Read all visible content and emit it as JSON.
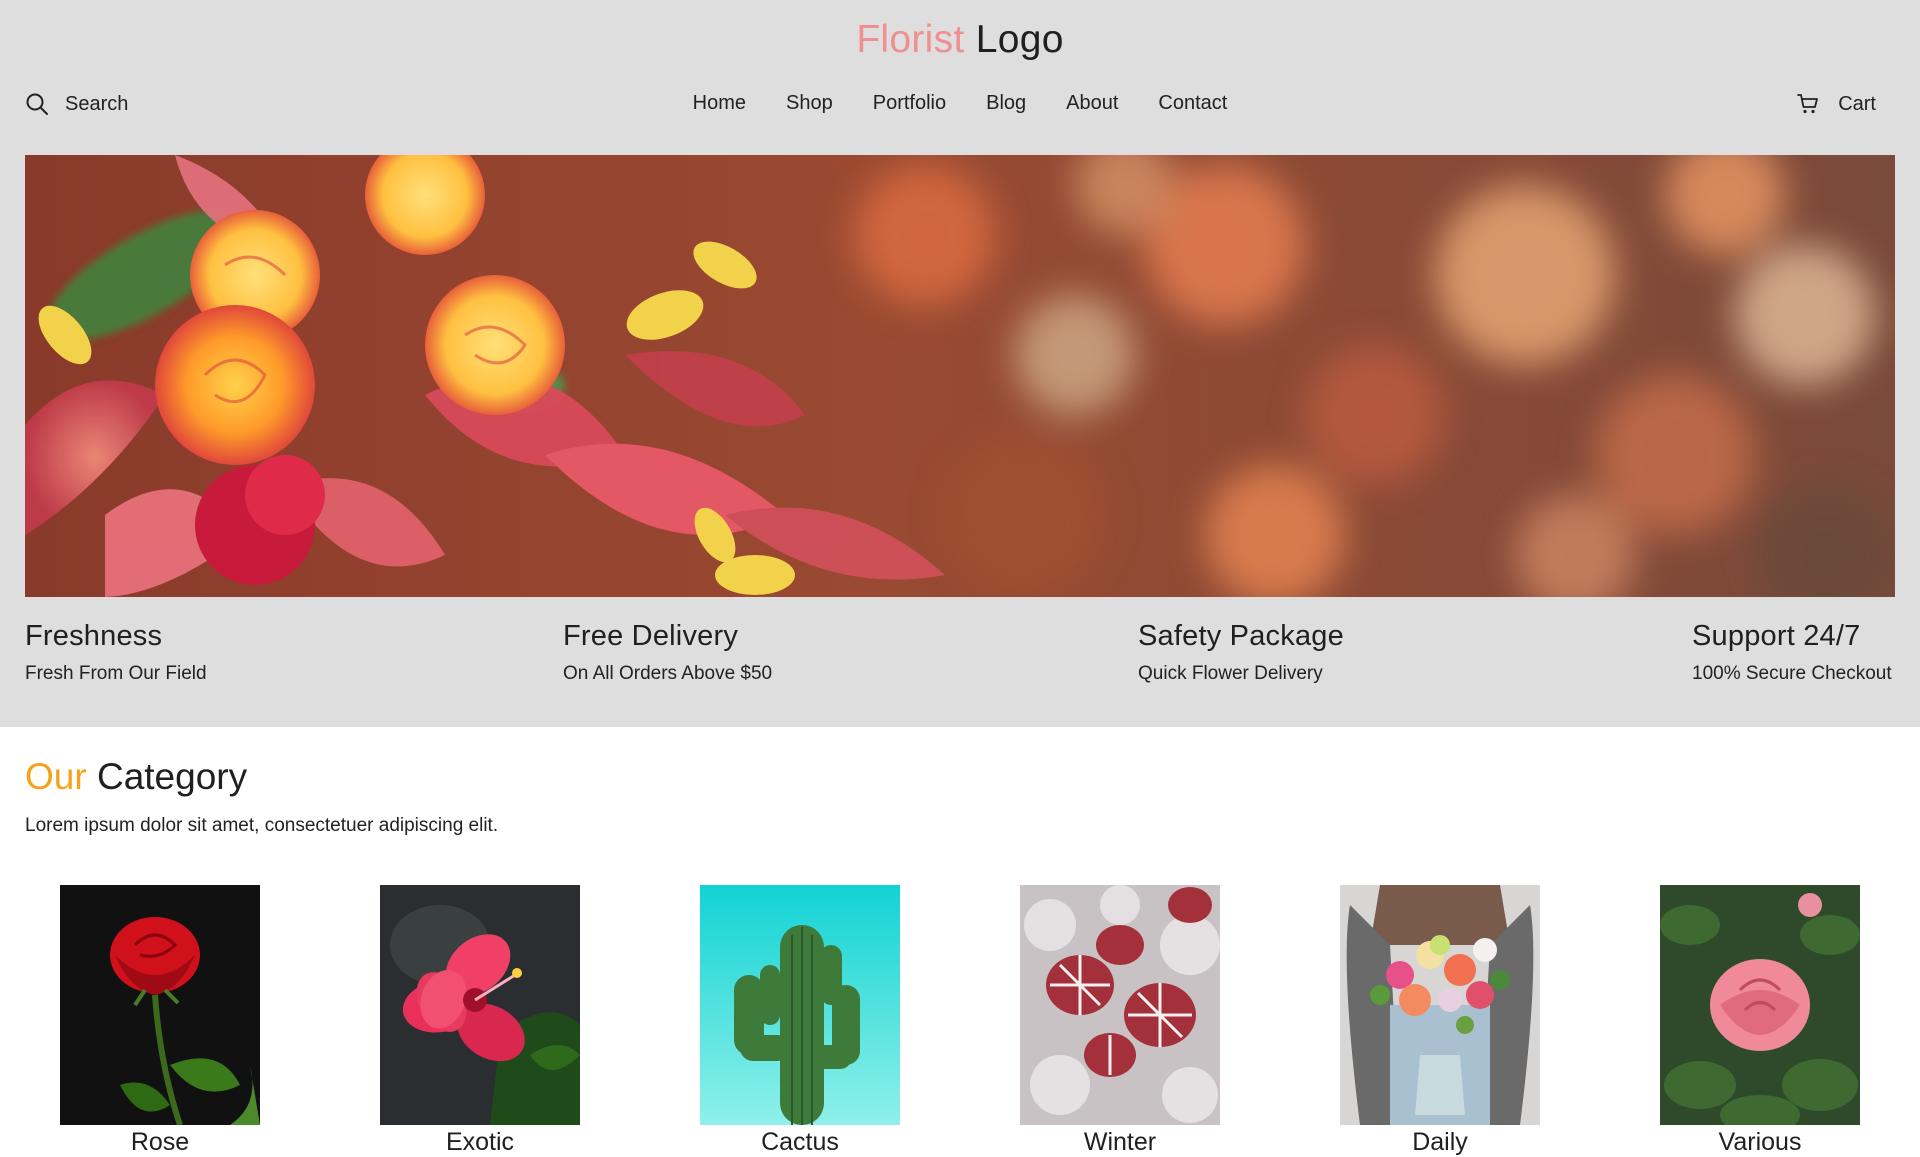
{
  "header": {
    "logo_accent": "Florist",
    "logo_rest": "Logo",
    "search_label": "Search",
    "cart_label": "Cart"
  },
  "nav": {
    "items": [
      "Home",
      "Shop",
      "Portfolio",
      "Blog",
      "About",
      "Contact"
    ]
  },
  "hero": {
    "image": "flower-bouquet-banner"
  },
  "features": [
    {
      "title": "Freshness",
      "subtitle": "Fresh From Our Field"
    },
    {
      "title": "Free Delivery",
      "subtitle": "On All Orders Above $50"
    },
    {
      "title": "Safety Package",
      "subtitle": "Quick Flower Delivery"
    },
    {
      "title": "Support 24/7",
      "subtitle": "100% Secure Checkout"
    }
  ],
  "category": {
    "title_accent": "Our",
    "title_rest": "Category",
    "description": "Lorem ipsum dolor sit amet, consectetuer adipiscing elit.",
    "items": [
      {
        "name": "Rose"
      },
      {
        "name": "Exotic"
      },
      {
        "name": "Cactus"
      },
      {
        "name": "Winter"
      },
      {
        "name": "Daily"
      },
      {
        "name": "Various"
      }
    ]
  },
  "colors": {
    "logo_accent": "#f08f8f",
    "category_accent": "#f4a21a",
    "top_background": "#dedede"
  }
}
